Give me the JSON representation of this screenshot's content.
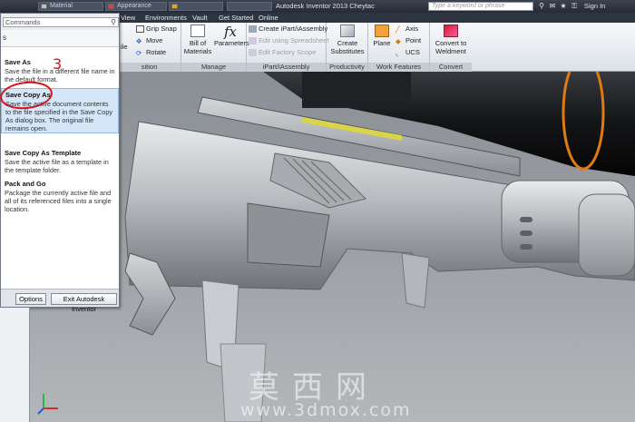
{
  "titlebar": {
    "qa_boxes": [
      {
        "label": "Material",
        "kind": "mat"
      },
      {
        "label": "Appearance",
        "kind": "app"
      },
      {
        "label": "",
        "kind": "fx"
      }
    ],
    "app_title": "Autodesk Inventor 2013   Cheytac",
    "search_placeholder": "Type a keyword or phrase",
    "signin": "Sign In"
  },
  "tabs": [
    "View",
    "Environments",
    "Vault",
    "Get Started",
    "Online"
  ],
  "ribbon": {
    "grip_snap": "Grip Snap",
    "move": "Move",
    "rotate": "Rotate",
    "partial_label": "ile",
    "position_group": "sition",
    "bill_of_materials": "Bill of Materials",
    "parameters": "Parameters",
    "manage_group": "Manage",
    "create_ipart": "Create iPart/iAssembly",
    "edit_spreadsheet": "Edit using Spreadsheet",
    "edit_factory": "Edit Factory Scope",
    "ipart_group": "iPart/iAssembly",
    "create_substitutes": "Create Substitutes",
    "productivity_group": "Productivity",
    "plane": "Plane",
    "axis": "Axis",
    "point": "Point",
    "ucs": "UCS",
    "work_group": "Work Features",
    "convert_weldment": "Convert to Weldment",
    "convert_group": "Convert"
  },
  "app_menu": {
    "search_placeholder": "Commands",
    "header": "s",
    "items": [
      {
        "title": "Save As",
        "desc": "Save the file in a different file name in the default format.",
        "selected": false
      },
      {
        "title": "Save Copy As",
        "desc": "Save the active document contents to the file specified in the Save Copy As dialog box. The original file remains open.",
        "selected": true
      },
      {
        "title": "Save Copy As Template",
        "desc": "Save the active file as a template in the template folder.",
        "selected": false
      },
      {
        "title": "Pack and Go",
        "desc": "Package the currently active file and all of its referenced files into a single location.",
        "selected": false
      }
    ],
    "options_button": "Options",
    "exit_button": "Exit Autodesk Inventor"
  },
  "annotation": {
    "step": "3",
    "color": "#d5121a"
  },
  "watermark": {
    "cn": "莫西网",
    "url": "www.3dmox.com"
  },
  "colors": {
    "accent_rail": "#d9d44a",
    "scope_ring": "#e07a12"
  }
}
